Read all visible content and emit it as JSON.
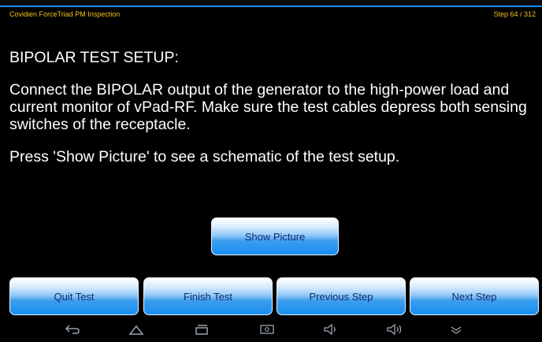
{
  "header": {
    "app_title": "Covidien ForceTriad PM Inspection",
    "step_indicator": "Step 64 / 312"
  },
  "instructions": {
    "heading": "BIPOLAR TEST SETUP:",
    "paragraph1": "Connect the BIPOLAR output of the generator to the high-power load and current monitor of vPad-RF. Make sure the test cables depress both sensing switches of the receptacle.",
    "paragraph2": "Press 'Show Picture' to see a schematic of the test setup."
  },
  "buttons": {
    "show_picture": "Show Picture",
    "quit_test": "Quit Test",
    "finish_test": "Finish Test",
    "previous_step": "Previous Step",
    "next_step": "Next Step"
  },
  "navbar": {
    "icons": [
      "back-icon",
      "home-icon",
      "recent-apps-icon",
      "screenshot-icon",
      "volume-down-icon",
      "volume-up-icon",
      "collapse-icon"
    ]
  },
  "colors": {
    "header_text": "#f3c21b",
    "accent_line": "#1e8bf0",
    "button_text": "#112a6e"
  }
}
